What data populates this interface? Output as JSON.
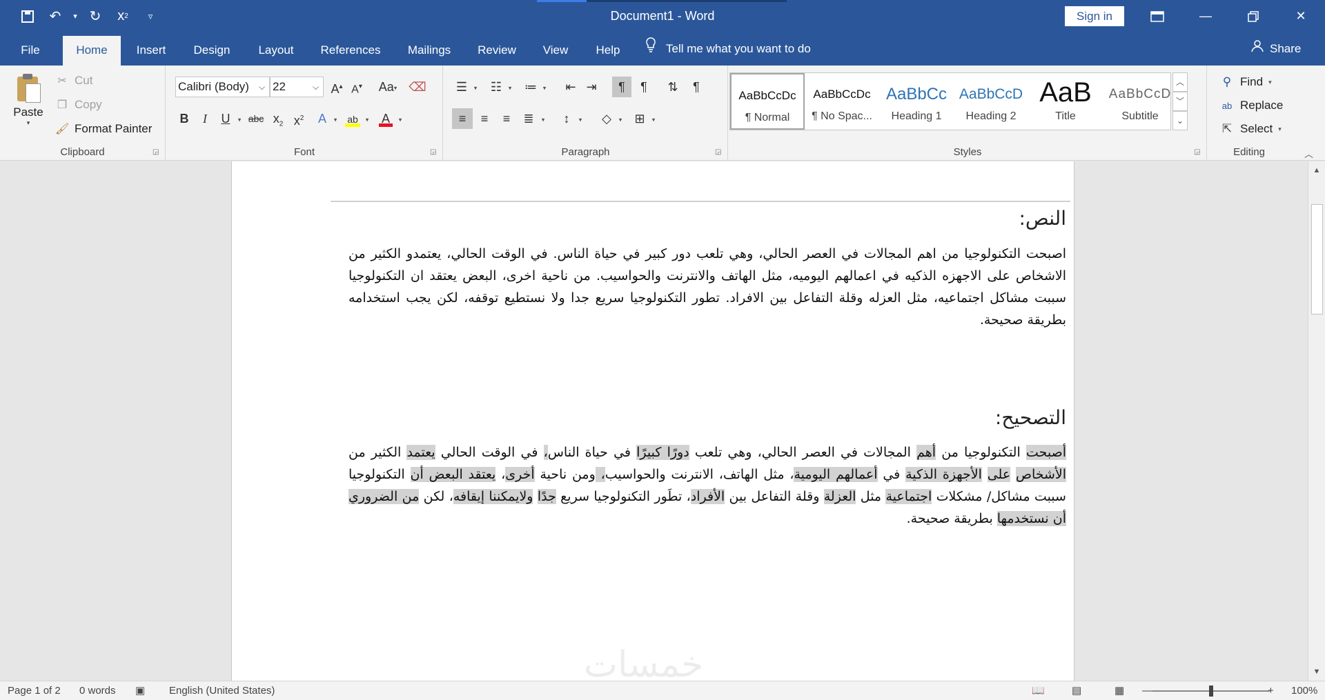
{
  "window": {
    "title": "Document1  -  Word",
    "sign_in": "Sign in"
  },
  "qat": {
    "save_icon": "save-icon",
    "undo_icon": "undo-icon",
    "redo_icon": "redo-icon",
    "superscript_icon": "superscript-icon",
    "customize_icon": "customize-icon"
  },
  "tabs": [
    "File",
    "Home",
    "Insert",
    "Design",
    "Layout",
    "References",
    "Mailings",
    "Review",
    "View",
    "Help"
  ],
  "tell_me": "Tell me what you want to do",
  "share": "Share",
  "clipboard": {
    "paste": "Paste",
    "cut": "Cut",
    "copy": "Copy",
    "format_painter": "Format Painter",
    "label": "Clipboard"
  },
  "font": {
    "family": "Calibri (Body)",
    "size": "22",
    "label": "Font",
    "font_color": "#e81123",
    "highlight_color": "#ffff00"
  },
  "paragraph": {
    "label": "Paragraph"
  },
  "styles": {
    "label": "Styles",
    "items": [
      {
        "sample": "AaBbCcDc",
        "name": "¶ Normal"
      },
      {
        "sample": "AaBbCcDc",
        "name": "¶ No Spac..."
      },
      {
        "sample": "AaBbCc",
        "name": "Heading 1"
      },
      {
        "sample": "AaBbCcD",
        "name": "Heading 2"
      },
      {
        "sample": "AaB",
        "name": "Title"
      },
      {
        "sample": "AaBbCcD",
        "name": "Subtitle"
      }
    ]
  },
  "editing": {
    "find": "Find",
    "replace": "Replace",
    "select": "Select",
    "label": "Editing"
  },
  "document": {
    "heading1": "النص:",
    "original_text": "اصبحت التكنولوجيا من اهم المجالات في العصر الحالي، وهي تلعب دور كبير في حياة الناس. في الوقت الحالي، يعتمدو الكثير من الاشخاص على الاجهزه الذكيه في اعمالهم اليوميه، مثل الهاتف والانترنت والحواسيب. من ناحية اخرى، البعض يعتقد ان التكنولوجيا سببت مشاكل اجتماعيه، مثل العزله وقلة التفاعل بين الافراد. تطور التكنولوجيا سريع جدا ولا نستطيع توقفه، لكن يجب استخدامه بطريقة صحيحة.",
    "heading2": "التصحيح:",
    "corrected": [
      {
        "t": "أصبحت",
        "h": true
      },
      {
        "t": " التكنولوجيا من ",
        "h": false
      },
      {
        "t": "أهم",
        "h": true
      },
      {
        "t": " المجالات في العصر الحالي، وهي تلعب ",
        "h": false
      },
      {
        "t": "دورًا كبيرًا",
        "h": true
      },
      {
        "t": " في حياة الناس",
        "h": false
      },
      {
        "t": "،",
        "h": true
      },
      {
        "t": " في الوقت الحالي ",
        "h": false
      },
      {
        "t": "يعتمد",
        "h": true
      },
      {
        "t": " الكثير من ",
        "h": false
      },
      {
        "t": "الأشخاص",
        "h": true
      },
      {
        "t": " ",
        "h": false
      },
      {
        "t": "على",
        "h": true
      },
      {
        "t": " ",
        "h": false
      },
      {
        "t": "الأجهزة الذكية",
        "h": true
      },
      {
        "t": " في ",
        "h": false
      },
      {
        "t": "أعمالهم اليومية",
        "h": true
      },
      {
        "t": "، مثل الهاتف، الانترنت والحواسيب",
        "h": false
      },
      {
        "t": "، ",
        "h": true
      },
      {
        "t": "ومن ناحية ",
        "h": false
      },
      {
        "t": "أخرى",
        "h": true
      },
      {
        "t": "، ",
        "h": false
      },
      {
        "t": "يعتقد البعض أن",
        "h": true
      },
      {
        "t": " التكنولوجيا سببت مشاكل/ مشكلات ",
        "h": false
      },
      {
        "t": "اجتماعية",
        "h": true
      },
      {
        "t": " مثل ",
        "h": false
      },
      {
        "t": "العزلة",
        "h": true
      },
      {
        "t": " وقلة التفاعل بين ",
        "h": false
      },
      {
        "t": "الأفراد",
        "h": true
      },
      {
        "t": "، تطَور التكنولوجيا سريع ",
        "h": false
      },
      {
        "t": "جدًا",
        "h": true
      },
      {
        "t": " ",
        "h": false
      },
      {
        "t": "ولايمكننا إيقافه",
        "h": true
      },
      {
        "t": "، لكن ",
        "h": false
      },
      {
        "t": "من الضروري أن نستخدمها",
        "h": true
      },
      {
        "t": " بطريقة صحيحة.",
        "h": false
      }
    ],
    "watermark": "خمسات"
  },
  "status": {
    "page": "Page 1 of 2",
    "words": "0 words",
    "language": "English (United States)",
    "zoom": "100%",
    "zoom_fraction": 0.5
  }
}
